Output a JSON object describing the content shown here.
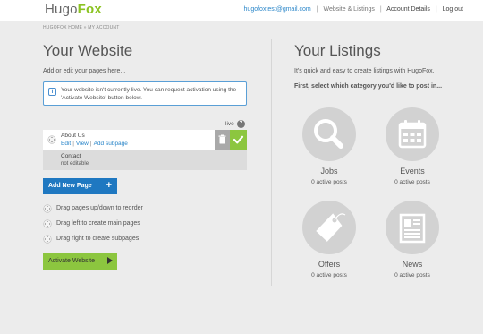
{
  "brand": {
    "name_part1": "Hugo",
    "name_part2": "Fox"
  },
  "topnav": {
    "email": "hugofoxtest@gmail.com",
    "website_listings": "Website & Listings",
    "account_details": "Account Details",
    "logout": "Log out"
  },
  "breadcrumb": {
    "home": "HUGOFOX HOME",
    "separator": "»",
    "current": "MY ACCOUNT"
  },
  "website": {
    "title": "Your Website",
    "subtitle": "Add or edit your pages here...",
    "info_icon": "i",
    "info_text": "Your website isn't currently live. You can request activation using the 'Activate Website' button below.",
    "live_label": "live",
    "help_icon": "?",
    "pages": [
      {
        "title": "About Us",
        "links": [
          "Edit",
          "View",
          "Add subpage"
        ],
        "link_sep": "|"
      },
      {
        "title": "Contact",
        "note": "not editable"
      }
    ],
    "add_button": "Add New Page",
    "add_button_icon": "+",
    "tips": [
      "Drag pages up/down to reorder",
      "Drag left to create main pages",
      "Drag right to create subpages"
    ],
    "activate_button": "Activate Website"
  },
  "listings": {
    "title": "Your Listings",
    "subtitle": "It's quick and easy to create listings with HugoFox.",
    "instruction": "First, select which category you'd like to post in...",
    "categories": [
      {
        "name": "Jobs",
        "count": "0 active posts",
        "icon": "magnifier-icon"
      },
      {
        "name": "Events",
        "count": "0 active posts",
        "icon": "calendar-icon"
      },
      {
        "name": "Offers",
        "count": "0 active posts",
        "icon": "tag-icon"
      },
      {
        "name": "News",
        "count": "0 active posts",
        "icon": "newspaper-icon"
      }
    ]
  },
  "colors": {
    "brand_green": "#8bc321",
    "link_blue": "#2a86c9",
    "button_blue": "#1f78c1",
    "button_green": "#8cc63f",
    "icon_circle": "#d2d2d2"
  }
}
